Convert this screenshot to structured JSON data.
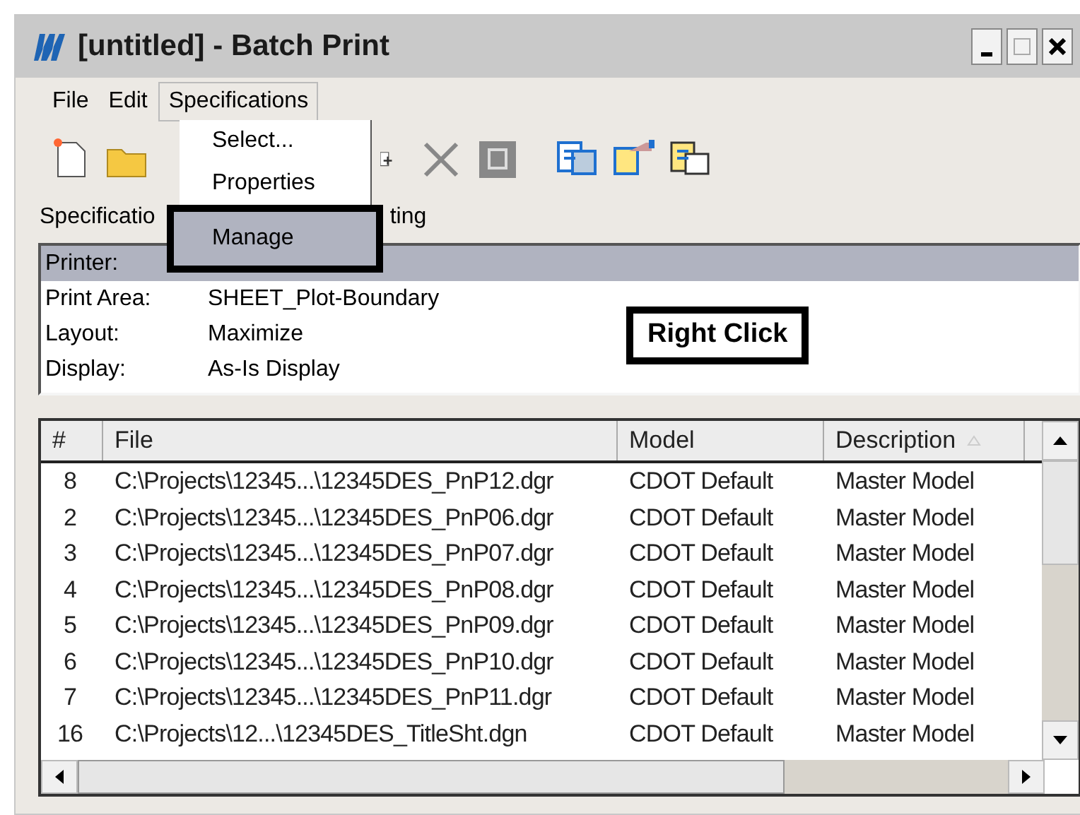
{
  "window": {
    "title": "[untitled] - Batch Print"
  },
  "menu_bar": [
    {
      "label": "File",
      "selected": false
    },
    {
      "label": "Edit",
      "selected": false
    },
    {
      "label": "Specifications",
      "selected": true
    }
  ],
  "menu": {
    "items": [
      {
        "label": "Select...",
        "selected": false
      },
      {
        "label": "Properties",
        "selected": false
      },
      {
        "label": "Manage",
        "selected": true
      }
    ]
  },
  "section_label": {
    "left": "Specificatio",
    "right": "ting"
  },
  "specification": [
    {
      "name": "Printer:",
      "selected": true
    },
    {
      "name": "Print Area:",
      "value": "SHEET_Plot-Boundary",
      "selected": false
    },
    {
      "name": "Layout:",
      "value": "Maximize",
      "selected": false
    },
    {
      "name": "Display:",
      "value": "As-Is Display",
      "selected": false
    }
  ],
  "callout": "Right Click",
  "table": {
    "columns": [
      "#",
      "File",
      "Model",
      "Description"
    ],
    "rows": [
      [
        "8",
        "C:\\Projects\\12345...\\12345DES_PnP12.dgr",
        "CDOT Default",
        "Master Model"
      ],
      [
        "2",
        "C:\\Projects\\12345...\\12345DES_PnP06.dgr",
        "CDOT Default",
        "Master Model"
      ],
      [
        "3",
        "C:\\Projects\\12345...\\12345DES_PnP07.dgr",
        "CDOT Default",
        "Master Model"
      ],
      [
        "4",
        "C:\\Projects\\12345...\\12345DES_PnP08.dgr",
        "CDOT Default",
        "Master Model"
      ],
      [
        "5",
        "C:\\Projects\\12345...\\12345DES_PnP09.dgr",
        "CDOT Default",
        "Master Model"
      ],
      [
        "6",
        "C:\\Projects\\12345...\\12345DES_PnP10.dgr",
        "CDOT Default",
        "Master Model"
      ],
      [
        "7",
        "C:\\Projects\\12345...\\12345DES_PnP11.dgr",
        "CDOT Default",
        "Master Model"
      ],
      [
        "16",
        "C:\\Projects\\12...\\12345DES_TitleSht.dgn",
        "CDOT Default",
        "Master Model"
      ]
    ]
  }
}
